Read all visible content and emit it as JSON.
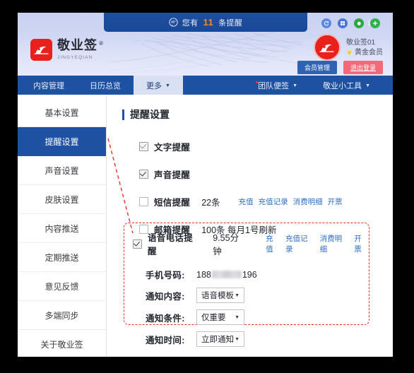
{
  "header": {
    "notify": {
      "icon": "speech-bubble-icon",
      "prefix": "您有",
      "count": "11",
      "suffix": "条提醒",
      "down_arrow": "↓"
    },
    "logo": {
      "title": "敬业签",
      "registered": "®",
      "subtitle": "JINGYEQIAN"
    },
    "top_icons": [
      {
        "name": "refresh-icon",
        "glyph": "↻",
        "color": "#5b8ae0"
      },
      {
        "name": "window-icon",
        "glyph": "▣",
        "color": "#4a74d6"
      },
      {
        "name": "apple-icon",
        "glyph": "",
        "color": "#2fa83f"
      },
      {
        "name": "android-icon",
        "glyph": "✛",
        "color": "#2fb24a"
      }
    ],
    "user": {
      "avatar": "user-avatar",
      "name": "敬业签01",
      "level": "黄金会员",
      "level_icon": "diamond-icon",
      "member_button": "会员管理",
      "logout_button": "退出登录"
    }
  },
  "nav": {
    "left": [
      {
        "label": "内容管理",
        "caret": false,
        "active": false
      },
      {
        "label": "日历总览",
        "caret": false,
        "active": false
      },
      {
        "label": "更多",
        "caret": true,
        "active": true
      }
    ],
    "right": [
      {
        "label": "团队便签",
        "caret": true,
        "dot": true
      },
      {
        "label": "敬业小工具",
        "caret": true,
        "dot": false
      }
    ]
  },
  "sidebar": {
    "items": [
      {
        "label": "基本设置",
        "active": false
      },
      {
        "label": "提醒设置",
        "active": true
      },
      {
        "label": "声音设置",
        "active": false
      },
      {
        "label": "皮肤设置",
        "active": false
      },
      {
        "label": "内容推送",
        "active": false
      },
      {
        "label": "定期推送",
        "active": false
      },
      {
        "label": "意见反馈",
        "active": false
      },
      {
        "label": "多端同步",
        "active": false
      },
      {
        "label": "关于敬业签",
        "active": false
      }
    ]
  },
  "panel": {
    "title": "提醒设置",
    "options": [
      {
        "label": "文字提醒",
        "checked": true,
        "dim": true,
        "extra": "",
        "links": []
      },
      {
        "label": "声音提醒",
        "checked": true,
        "dim": false,
        "extra": "",
        "links": []
      },
      {
        "label": "短信提醒",
        "checked": false,
        "dim": false,
        "extra": "22条",
        "links": [
          "充值",
          "充值记录",
          "消费明细",
          "开票"
        ]
      },
      {
        "label": "邮箱提醒",
        "checked": false,
        "dim": false,
        "extra": "100条 每月1号刷新",
        "links": []
      }
    ],
    "voice": {
      "label": "语音电话提醒",
      "checked": true,
      "balance": "9.55分钟",
      "links": [
        "充值",
        "充值记录",
        "消费明细",
        "开票"
      ],
      "phone": {
        "label": "手机号码:",
        "prefix": "188",
        "masked": true,
        "suffix": "196"
      },
      "fields": [
        {
          "label": "通知内容:",
          "value": "语音模板"
        },
        {
          "label": "通知条件:",
          "value": "仅重要"
        },
        {
          "label": "通知时间:",
          "value": "立即通知"
        }
      ]
    }
  },
  "colors": {
    "nav_blue": "#1f51a3",
    "accent_red": "#e8211d",
    "link_blue": "#2f6fc4",
    "highlight_dashed": "#ee2b2b",
    "notify_orange": "#ff8a1f"
  }
}
